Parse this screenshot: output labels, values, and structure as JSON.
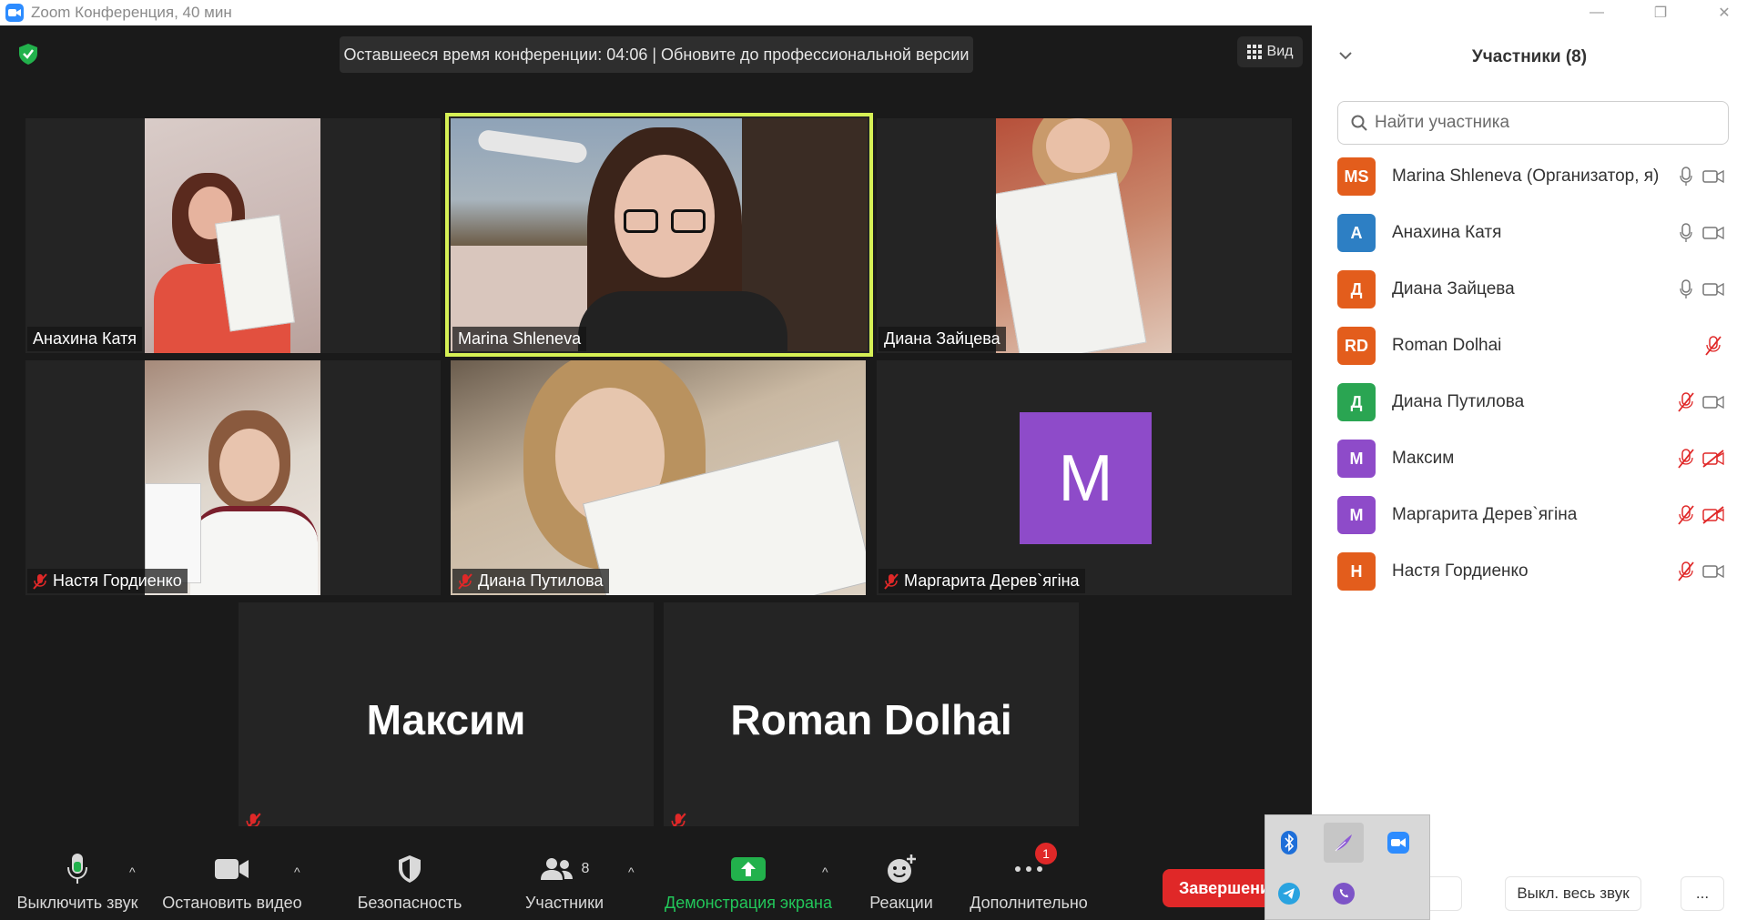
{
  "window": {
    "title": "Zoom Конференция, 40 мин"
  },
  "meeting": {
    "timer_text": "Оставшееся время конференции: 04:06 | Обновите до профессиональной версии",
    "view_label": "Вид"
  },
  "tiles": [
    {
      "name": "Анахина Катя",
      "muted": false,
      "active": false
    },
    {
      "name": "Marina Shleneva",
      "muted": false,
      "active": true
    },
    {
      "name": "Диана Зайцева",
      "muted": false,
      "active": false
    },
    {
      "name": "Настя Гордиенко",
      "muted": true,
      "active": false
    },
    {
      "name": "Диана Путилова",
      "muted": true,
      "active": false
    },
    {
      "name": "Маргарита Дерев`ягіна",
      "muted": true,
      "active": false,
      "avatar_letter": "M"
    },
    {
      "name": "Максим",
      "muted": true,
      "active": false
    },
    {
      "name": "Roman Dolhai",
      "muted": true,
      "active": false
    }
  ],
  "toolbar": {
    "mute_label": "Выключить звук",
    "video_label": "Остановить видео",
    "security_label": "Безопасность",
    "participants_label": "Участники",
    "participants_count": "8",
    "share_label": "Демонстрация экрана",
    "reactions_label": "Реакции",
    "more_label": "Дополнительно",
    "more_badge": "1",
    "end_label": "Завершени"
  },
  "panel": {
    "title": "Участники (8)",
    "search_placeholder": "Найти участника",
    "participants": [
      {
        "initials": "MS",
        "name": "Marina Shleneva (Организатор, я)",
        "color": "#e35d1c",
        "mic": "on",
        "video": "on"
      },
      {
        "initials": "А",
        "name": "Анахина Катя",
        "color": "#2d7fc4",
        "mic": "on",
        "video": "on"
      },
      {
        "initials": "Д",
        "name": "Диана Зайцева",
        "color": "#e35d1c",
        "mic": "on",
        "video": "on"
      },
      {
        "initials": "RD",
        "name": "Roman Dolhai",
        "color": "#e35d1c",
        "mic": "muted",
        "video": "none"
      },
      {
        "initials": "Д",
        "name": "Диана Путилова",
        "color": "#2aa552",
        "mic": "muted",
        "video": "on"
      },
      {
        "initials": "М",
        "name": "Максим",
        "color": "#8e4bc9",
        "mic": "muted",
        "video": "off"
      },
      {
        "initials": "М",
        "name": "Маргарита Дерев`ягіна",
        "color": "#8e4bc9",
        "mic": "muted",
        "video": "off"
      },
      {
        "initials": "Н",
        "name": "Настя Гордиенко",
        "color": "#e35d1c",
        "mic": "muted",
        "video": "on"
      }
    ],
    "invite_partial": "ить",
    "mute_all_label": "Выкл. весь звук",
    "more_label": "..."
  },
  "tray": {
    "icons": [
      "bluetooth-icon",
      "feather-icon",
      "zoom-icon",
      "telegram-icon",
      "viber-icon"
    ]
  }
}
